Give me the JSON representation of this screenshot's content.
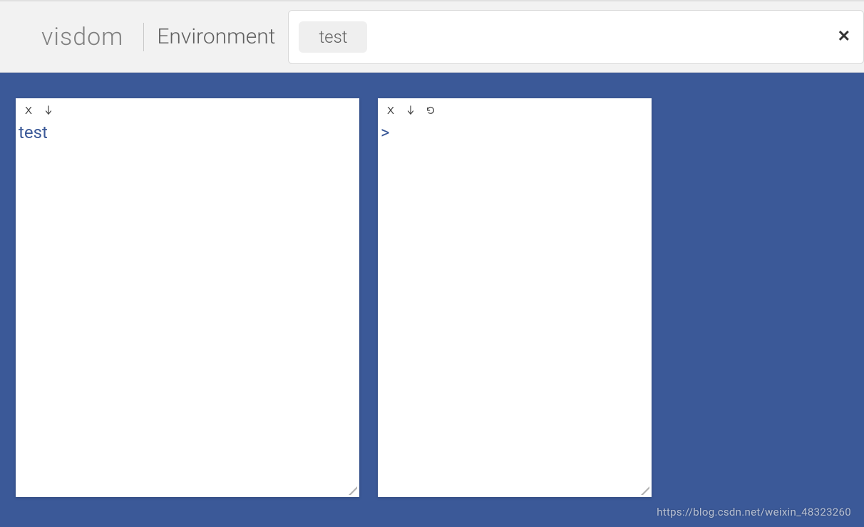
{
  "navbar": {
    "brand": "visdom",
    "env_label": "Environment",
    "env_tag": "test",
    "clear_symbol": "✕"
  },
  "panels": [
    {
      "icons": [
        "x",
        "arrow-down"
      ],
      "content": "test"
    },
    {
      "icons": [
        "x",
        "arrow-down",
        "refresh"
      ],
      "content": ">"
    }
  ],
  "watermark": "https://blog.csdn.net/weixin_48323260"
}
